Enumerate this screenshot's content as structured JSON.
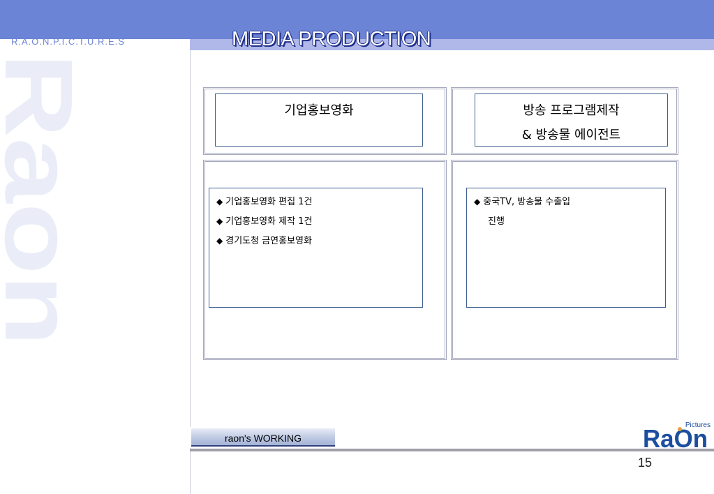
{
  "brand": {
    "spaced_name": "R.A.O.N.P.I.C.T.U.R.E.S",
    "watermark": "Raon"
  },
  "header": {
    "title": "MEDIA PRODUCTION"
  },
  "left_card": {
    "title": "기업홍보영화",
    "items": [
      "기업홍보영화 편집 1건",
      "기업홍보영화 제작 1건",
      "경기도청 금연홍보영화"
    ]
  },
  "right_card": {
    "title_line1": "방송 프로그램제작",
    "title_line2": "& 방송물 에이전트",
    "item_line1": "중국TV, 방송물 수출입",
    "item_line2": "진행"
  },
  "footer": {
    "tab_label": "raon's  WORKING",
    "page_number": "15"
  },
  "logo": {
    "text_main": "RaOn",
    "text_sub": "Pictures"
  },
  "colors": {
    "header_band": "#6c84d6",
    "strip": "#b0b8ea",
    "watermark": "#eaedf8",
    "box_border": "#3e5e92",
    "logo_blue": "#1c4ea0",
    "logo_orange": "#e8a23a"
  }
}
